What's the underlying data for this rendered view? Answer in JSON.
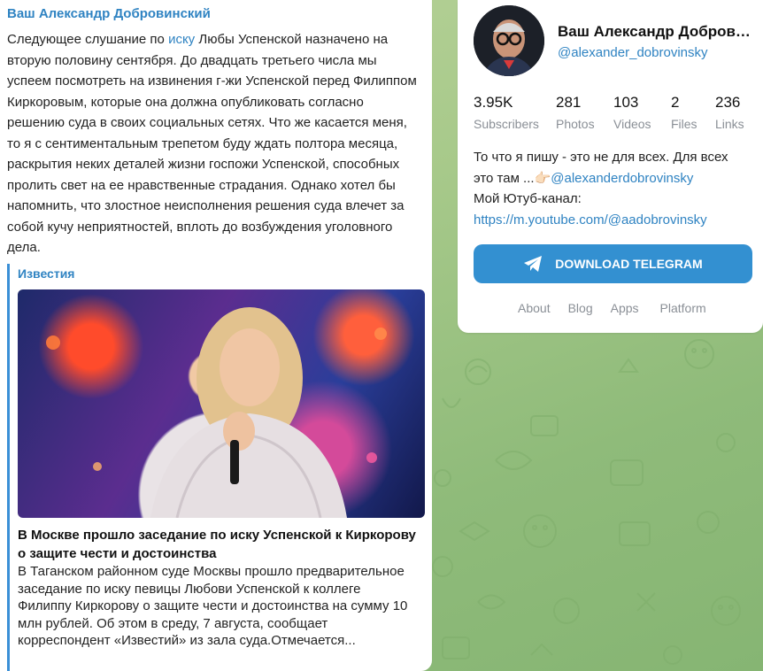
{
  "post": {
    "author": "Ваш Александр Добровинский",
    "text_before_link": "Следующее слушание по ",
    "text_link": "иску",
    "text_after_link": " Любы Успенской назначено на вторую половину сентября. До двадцать третьего числа мы успеем посмотреть на извинения г-жи Успенской перед Филиппом Киркоровым, которые она должна опубликовать согласно решению суда в своих социальных сетях. Что же касается меня, то я с сентиментальным трепетом буду ждать полтора месяца, раскрытия неких деталей жизни госпожи Успенской, способных пролить свет на ее нравственные страдания. Однако хотел бы напомнить, что злостное неисполнения решения суда влечет за собой кучу неприятностей, вплоть до возбуждения уголовного дела."
  },
  "preview": {
    "site": "Известия",
    "title": "В Москве прошло заседание по иску Успенской к Киркорову о защите чести и достоинства",
    "description": "В Таганском районном суде Москвы прошло предварительное заседание по иску певицы Любови Успенской к коллеге Филиппу Киркорову о защите чести и достоинства на сумму 10 млн рублей. Об этом в среду, 7 августа, сообщает корреспондент «Известий» из зала суда.Отмечается..."
  },
  "profile": {
    "name": "Ваш Александр Добров…",
    "handle": "@alexander_dobrovinsky",
    "stats": [
      {
        "value": "3.95K",
        "label": "Subscribers"
      },
      {
        "value": "281",
        "label": "Photos"
      },
      {
        "value": "103",
        "label": "Videos"
      },
      {
        "value": "2",
        "label": "Files"
      },
      {
        "value": "236",
        "label": "Links"
      }
    ],
    "bio_line1": "То что я пишу - это не для всех. Для всех",
    "bio_line2_text": "это там ...👉🏻",
    "bio_line2_link": "@alexanderdobrovinsky",
    "bio_line3": "Мой Ютуб-канал:",
    "bio_line4_link": "https://m.youtube.com/@aadobrovinsky",
    "download_label": "DOWNLOAD TELEGRAM",
    "footer": [
      "About",
      "Blog",
      "Apps",
      "Platform"
    ]
  },
  "colors": {
    "accent": "#3390d1",
    "link": "#2f83c2",
    "background_green": "#a7c98a"
  },
  "icons": [
    "telegram-plane-icon"
  ]
}
